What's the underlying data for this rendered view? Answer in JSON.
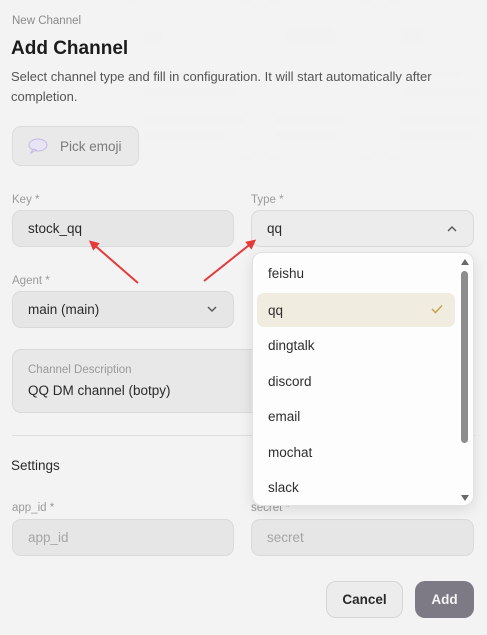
{
  "dialog": {
    "eyebrow": "New Channel",
    "title": "Add Channel",
    "subtitle": "Select channel type and fill in configuration. It will start automatically after completion."
  },
  "emoji": {
    "label": "Pick emoji",
    "icon": "speech-bubble-icon"
  },
  "form": {
    "key": {
      "label": "Key *",
      "value": "stock_qq"
    },
    "type": {
      "label": "Type *",
      "value": "qq"
    },
    "agent": {
      "label": "Agent *",
      "value": "main (main)"
    },
    "description": {
      "label": "Channel Description",
      "value": "QQ DM channel (botpy)"
    }
  },
  "settings": {
    "title": "Settings",
    "app_id": {
      "label": "app_id *",
      "placeholder": "app_id"
    },
    "secret": {
      "label": "secret *",
      "placeholder": "secret"
    }
  },
  "type_dropdown": {
    "selected": "qq",
    "options": [
      "feishu",
      "qq",
      "dingtalk",
      "discord",
      "email",
      "mochat",
      "slack"
    ]
  },
  "actions": {
    "cancel": "Cancel",
    "add": "Add"
  },
  "colors": {
    "add_button": "#7d7a86",
    "selected_option_bg": "#f1ece0",
    "check_mark": "#c8a24a",
    "annotation_arrow": "#e53a3a"
  }
}
